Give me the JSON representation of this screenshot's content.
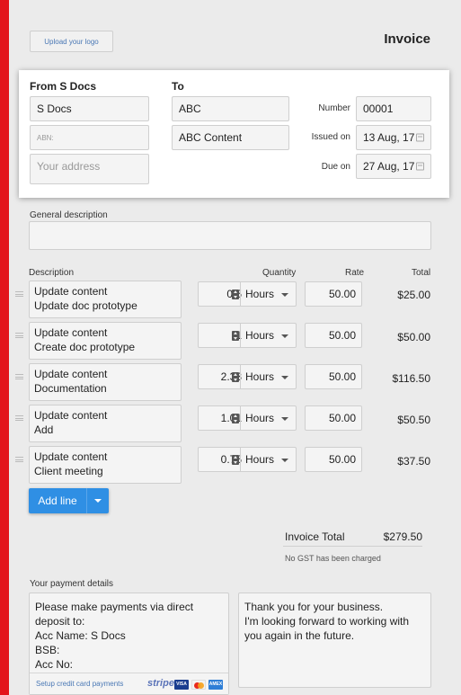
{
  "header": {
    "upload_logo": "Upload your logo",
    "title": "Invoice"
  },
  "from": {
    "heading": "From S Docs",
    "name": "S Docs",
    "abn_placeholder": "ABN:",
    "address_placeholder": "Your address"
  },
  "to": {
    "heading": "To",
    "name": "ABC",
    "company": "ABC Content"
  },
  "meta": {
    "number_label": "Number",
    "number": "00001",
    "issued_label": "Issued on",
    "issued": "13 Aug, 17",
    "due_label": "Due on",
    "due": "27 Aug, 17"
  },
  "general": {
    "label": "General description",
    "value": ""
  },
  "columns": {
    "description": "Description",
    "quantity": "Quantity",
    "rate": "Rate",
    "total": "Total"
  },
  "lines": [
    {
      "line1": "Update content",
      "line2": "Update doc prototype",
      "qty": "0.5",
      "unit": "Hours",
      "rate": "50.00",
      "total": "$25.00"
    },
    {
      "line1": "Update content",
      "line2": "Create doc prototype",
      "qty": "1",
      "unit": "Hours",
      "rate": "50.00",
      "total": "$50.00"
    },
    {
      "line1": "Update content",
      "line2": "Documentation",
      "qty": "2.33",
      "unit": "Hours",
      "rate": "50.00",
      "total": "$116.50"
    },
    {
      "line1": "Update content",
      "line2": "Add",
      "qty": "1.01",
      "unit": "Hours",
      "rate": "50.00",
      "total": "$50.50"
    },
    {
      "line1": "Update content",
      "line2": "Client meeting",
      "qty": "0.75",
      "unit": "Hours",
      "rate": "50.00",
      "total": "$37.50"
    }
  ],
  "add_line": "Add line",
  "summary": {
    "label": "Invoice Total",
    "value": "$279.50",
    "gst_note": "No GST has been charged"
  },
  "payment": {
    "label": "Your payment details",
    "lines": [
      "Please make payments via direct",
      "deposit to:",
      "Acc Name: S Docs",
      "BSB:",
      "Acc No:"
    ],
    "setup_link": "Setup credit card payments",
    "stripe": "stripe",
    "cards": [
      "VISA",
      "MC",
      "AMEX"
    ]
  },
  "notes": {
    "lines": [
      "Thank you for your business.",
      "I'm looking forward to working with",
      "you again in the future."
    ]
  },
  "colors": {
    "accent": "#e3141c",
    "button": "#2f8fe4",
    "link": "#4a78b5"
  }
}
